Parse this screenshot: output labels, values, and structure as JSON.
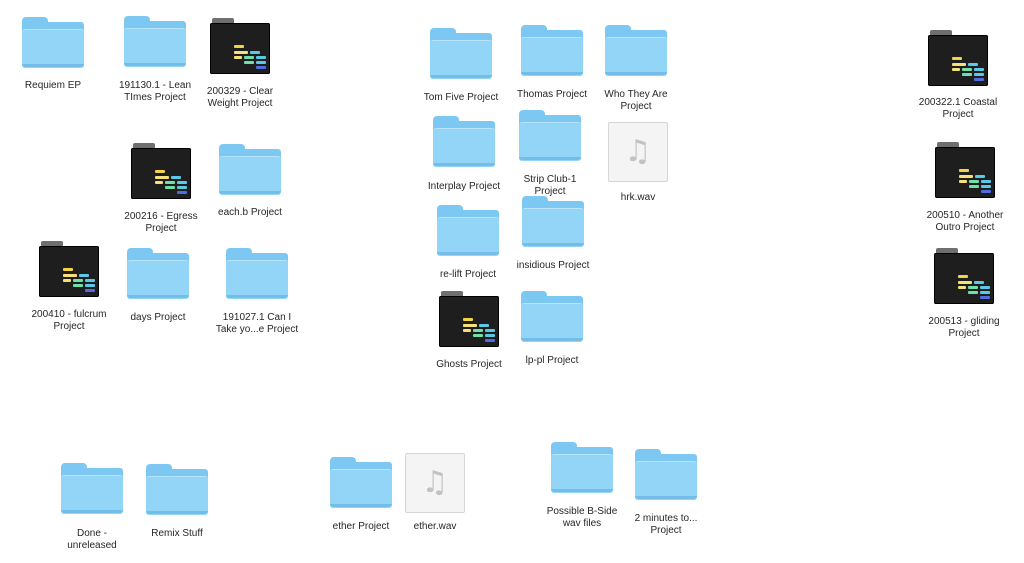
{
  "items": [
    {
      "name": "Requiem EP",
      "type": "folder"
    },
    {
      "name": "191130.1 - Lean\nTImes Project",
      "type": "folder"
    },
    {
      "name": "200329 - Clear\nWeight Project",
      "type": "project"
    },
    {
      "name": "200216 - Egress\nProject",
      "type": "project"
    },
    {
      "name": "each.b Project",
      "type": "folder"
    },
    {
      "name": "200410 - fulcrum\nProject",
      "type": "project"
    },
    {
      "name": "days Project",
      "type": "folder"
    },
    {
      "name": "191027.1 Can I\nTake yo...e Project",
      "type": "folder"
    },
    {
      "name": "Tom Five Project",
      "type": "folder"
    },
    {
      "name": "Thomas Project",
      "type": "folder"
    },
    {
      "name": "Who They Are\nProject",
      "type": "folder"
    },
    {
      "name": "Interplay Project",
      "type": "folder"
    },
    {
      "name": "Strip Club-1\nProject",
      "type": "folder"
    },
    {
      "name": "hrk.wav",
      "type": "audio"
    },
    {
      "name": "re-lift Project",
      "type": "folder"
    },
    {
      "name": "insidious Project",
      "type": "folder"
    },
    {
      "name": "Ghosts Project",
      "type": "project"
    },
    {
      "name": "lp-pl Project",
      "type": "folder"
    },
    {
      "name": "200322.1 Coastal\nProject",
      "type": "project"
    },
    {
      "name": "200510 - Another\nOutro Project",
      "type": "project"
    },
    {
      "name": "200513 - gliding\nProject",
      "type": "project"
    },
    {
      "name": "Done -\nunreleased",
      "type": "folder"
    },
    {
      "name": "Remix Stuff",
      "type": "folder"
    },
    {
      "name": "ether Project",
      "type": "folder"
    },
    {
      "name": "ether.wav",
      "type": "audio"
    },
    {
      "name": "Possible B-Side\nwav files",
      "type": "folder"
    },
    {
      "name": "2 minutes to...\nProject",
      "type": "folder"
    }
  ],
  "colors": {
    "folder_front": "#92d5f7",
    "folder_back": "#7cc8f2",
    "project_bg": "#1e1e1e",
    "project_bars": [
      "#f2d24a",
      "#f5e07a",
      "#6fe0a8",
      "#5bc8e8",
      "#4f6de0"
    ]
  }
}
